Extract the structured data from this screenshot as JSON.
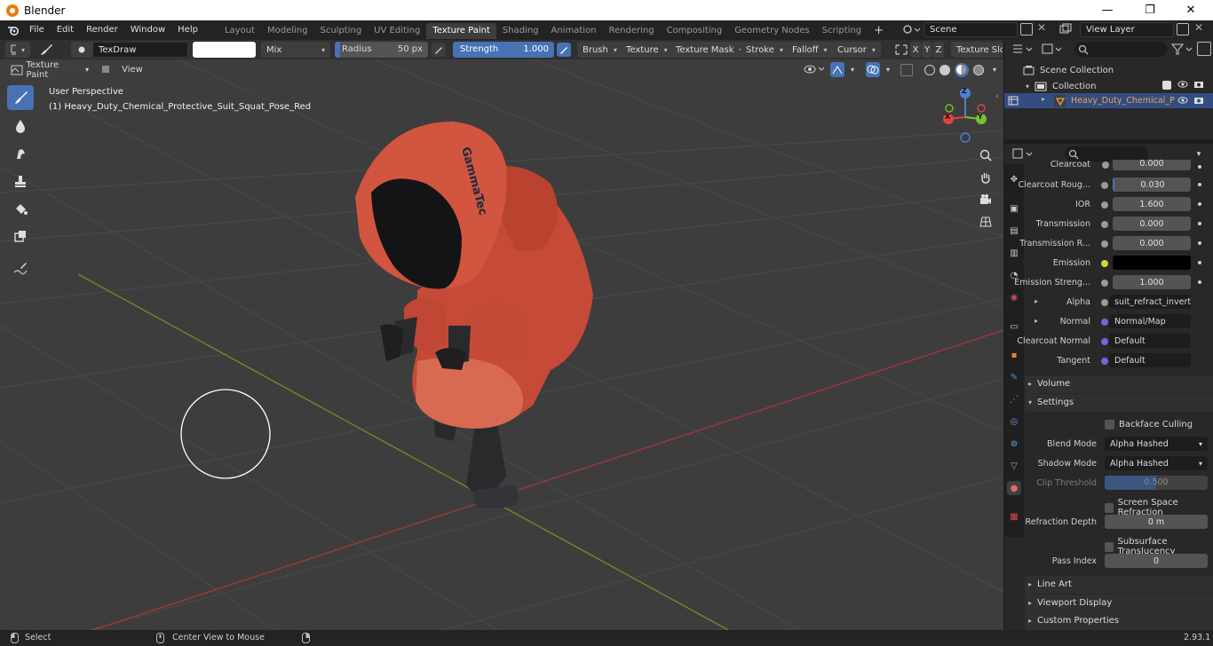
{
  "window": {
    "title": "Blender",
    "minimize": "—",
    "maximize": "❐",
    "close": "✕"
  },
  "menu": {
    "items": [
      "File",
      "Edit",
      "Render",
      "Window",
      "Help"
    ]
  },
  "workspaces": {
    "tabs": [
      "Layout",
      "Modeling",
      "Sculpting",
      "UV Editing",
      "Texture Paint",
      "Shading",
      "Animation",
      "Rendering",
      "Compositing",
      "Geometry Nodes",
      "Scripting"
    ],
    "active": "Texture Paint",
    "add": "+"
  },
  "scene": {
    "value": "Scene"
  },
  "view_layer": {
    "value": "View Layer"
  },
  "tool_header": {
    "brush_name": "TexDraw",
    "blend": "Mix",
    "radius_label": "Radius",
    "radius_value": "50 px",
    "strength_label": "Strength",
    "strength_value": "1.000",
    "menus": [
      "Brush",
      "Texture",
      "Texture Mask",
      "Stroke",
      "Falloff",
      "Cursor"
    ],
    "axes": [
      "X",
      "Y",
      "Z"
    ],
    "texture_slots": "Texture Slots"
  },
  "viewport_header": {
    "mode": "Texture Paint",
    "view": "View"
  },
  "viewport": {
    "perspective": "User Perspective",
    "object_info": "(1) Heavy_Duty_Chemical_Protective_Suit_Squat_Pose_Red",
    "gizmo": {
      "z": "Z",
      "y": "Y",
      "x": "X"
    },
    "model_text": "GammaTec"
  },
  "outliner": {
    "scene_collection": "Scene Collection",
    "collection": "Collection",
    "object": "Heavy_Duty_Chemical_P"
  },
  "properties": {
    "rows": [
      {
        "label": "Clearcoat",
        "value": "0.000"
      },
      {
        "label": "Clearcoat Roug...",
        "value": "0.030"
      },
      {
        "label": "IOR",
        "value": "1.600"
      },
      {
        "label": "Transmission",
        "value": "0.000"
      },
      {
        "label": "Transmission R...",
        "value": "0.000"
      },
      {
        "label": "Emission",
        "value": ""
      },
      {
        "label": "Emission Streng...",
        "value": "1.000"
      }
    ],
    "alpha": {
      "label": "Alpha",
      "value": "suit_refract_invert.pn"
    },
    "normal": {
      "label": "Normal",
      "value": "Normal/Map"
    },
    "clearcoat_normal": {
      "label": "Clearcoat Normal",
      "value": "Default"
    },
    "tangent": {
      "label": "Tangent",
      "value": "Default"
    },
    "volume": "Volume",
    "settings": "Settings",
    "backface_culling": "Backface Culling",
    "blend_mode": {
      "label": "Blend Mode",
      "value": "Alpha Hashed"
    },
    "shadow_mode": {
      "label": "Shadow Mode",
      "value": "Alpha Hashed"
    },
    "clip_threshold": {
      "label": "Clip Threshold",
      "value": "0.500"
    },
    "screen_space_refraction": "Screen Space Refraction",
    "refraction_depth": {
      "label": "Refraction Depth",
      "value": "0 m"
    },
    "subsurface_translucency": "Subsurface Translucency",
    "pass_index": {
      "label": "Pass Index",
      "value": "0"
    },
    "line_art": "Line Art",
    "viewport_display": "Viewport Display",
    "custom_properties": "Custom Properties"
  },
  "status": {
    "select": "Select",
    "center_view": "Center View to Mouse",
    "version": "2.93.1"
  },
  "colors": {
    "accent": "#4772b3",
    "suit": "#c8503e",
    "grid_x": "#9b3a3a",
    "grid_y": "#6e8a26"
  }
}
